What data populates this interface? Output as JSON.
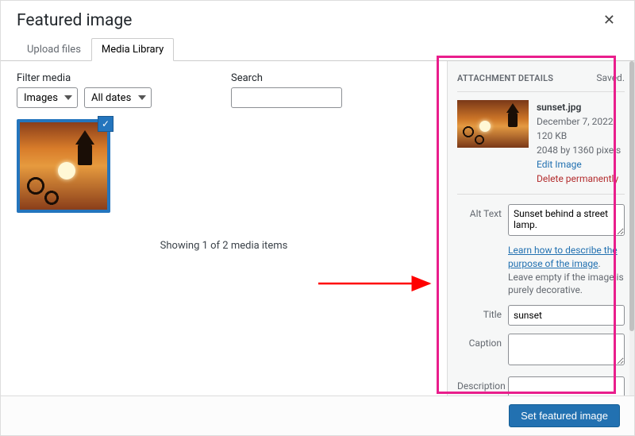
{
  "header": {
    "title": "Featured image"
  },
  "tabs": {
    "upload": "Upload files",
    "library": "Media Library"
  },
  "filters": {
    "filter_label": "Filter media",
    "type_value": "Images",
    "date_value": "All dates",
    "search_label": "Search"
  },
  "status": "Showing 1 of 2 media items",
  "sidebar": {
    "heading": "ATTACHMENT DETAILS",
    "saved": "Saved.",
    "filename": "sunset.jpg",
    "date": "December 7, 2022",
    "size": "120 KB",
    "dimensions": "2048 by 1360 pixels",
    "edit_link": "Edit Image",
    "delete_link": "Delete permanently",
    "alt_label": "Alt Text",
    "alt_value": "Sunset behind a street lamp.",
    "alt_help_link": "Learn how to describe the purpose of the image",
    "alt_help_rest": ". Leave empty if the image is purely decorative.",
    "title_label": "Title",
    "title_value": "sunset",
    "caption_label": "Caption",
    "caption_value": "",
    "description_label": "Description",
    "description_value": ""
  },
  "footer": {
    "set_button": "Set featured image"
  }
}
